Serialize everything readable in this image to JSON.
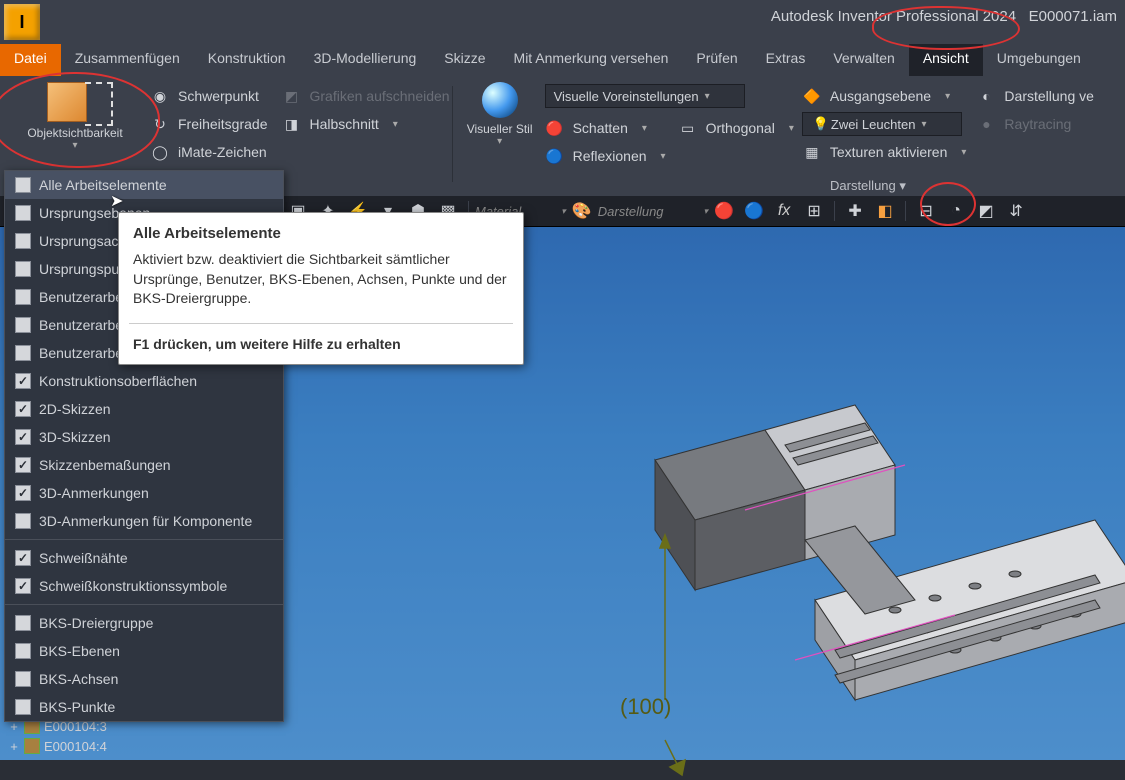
{
  "title": {
    "app": "Autodesk Inventor Professional 2024",
    "file": "E000071.iam",
    "icon_letter": "I"
  },
  "tabs": {
    "file": "Datei",
    "items": [
      "Zusammenfügen",
      "Konstruktion",
      "3D-Modellierung",
      "Skizze",
      "Mit Anmerkung versehen",
      "Prüfen",
      "Extras",
      "Verwalten",
      "Ansicht",
      "Umgebungen"
    ],
    "active": "Ansicht"
  },
  "ribbon": {
    "object_vis": "Objektsichtbarkeit",
    "col1": {
      "schwerpunkt": "Schwerpunkt",
      "freiheitsgrade": "Freiheitsgrade",
      "imate": "iMate-Zeichen"
    },
    "col2": {
      "grafiken": "Grafiken aufschneiden",
      "halbschnitt": "Halbschnitt"
    },
    "visual_style": "Visueller Stil",
    "vs_combo": "Visuelle Voreinstellungen",
    "col3": {
      "schatten": "Schatten",
      "reflex": "Reflexionen"
    },
    "col4": {
      "ortho": "Orthogonal"
    },
    "col5": {
      "ausgang": "Ausgangsebene",
      "zwei": "Zwei Leuchten",
      "textur": "Texturen aktivieren"
    },
    "col6": {
      "darstellung": "Darstellung ve",
      "raytracing": "Raytracing"
    },
    "panel_label": "Darstellung"
  },
  "toolbar2": {
    "material": "Material",
    "darstellung": "Darstellung"
  },
  "dropdown": {
    "items": [
      {
        "label": "Alle Arbeitselemente",
        "checked": false,
        "hover": true
      },
      {
        "label": "Ursprungsebenen",
        "checked": false
      },
      {
        "label": "Ursprungsachsen",
        "checked": false
      },
      {
        "label": "Ursprungspunkte",
        "checked": false
      },
      {
        "label": "Benutzerarbeitsebenen",
        "checked": false
      },
      {
        "label": "Benutzerarbeitsachsen",
        "checked": false
      },
      {
        "label": "Benutzerarbeitspunkte",
        "checked": false
      },
      {
        "label": "Konstruktionsoberflächen",
        "checked": true
      },
      {
        "label": "2D-Skizzen",
        "checked": true
      },
      {
        "label": "3D-Skizzen",
        "checked": true
      },
      {
        "label": "Skizzenbemaßungen",
        "checked": true
      },
      {
        "label": "3D-Anmerkungen",
        "checked": true
      },
      {
        "label": "3D-Anmerkungen für Komponente",
        "checked": false
      },
      {
        "sep": true
      },
      {
        "label": "Schweißnähte",
        "checked": true
      },
      {
        "label": "Schweißkonstruktionssymbole",
        "checked": true
      },
      {
        "sep": true
      },
      {
        "label": "BKS-Dreiergruppe",
        "checked": false
      },
      {
        "label": "BKS-Ebenen",
        "checked": false
      },
      {
        "label": "BKS-Achsen",
        "checked": false
      },
      {
        "label": "BKS-Punkte",
        "checked": false
      }
    ]
  },
  "tooltip": {
    "title": "Alle Arbeitselemente",
    "body": "Aktiviert bzw. deaktiviert die Sichtbarkeit sämtlicher Ursprünge, Benutzer, BKS-Ebenen, Achsen, Punkte und der BKS-Dreiergruppe.",
    "help": "F1 drücken, um weitere Hilfe zu erhalten"
  },
  "tree": {
    "a": "E000104:3",
    "b": "E000104:4"
  },
  "viewport": {
    "dim": "(100)"
  }
}
